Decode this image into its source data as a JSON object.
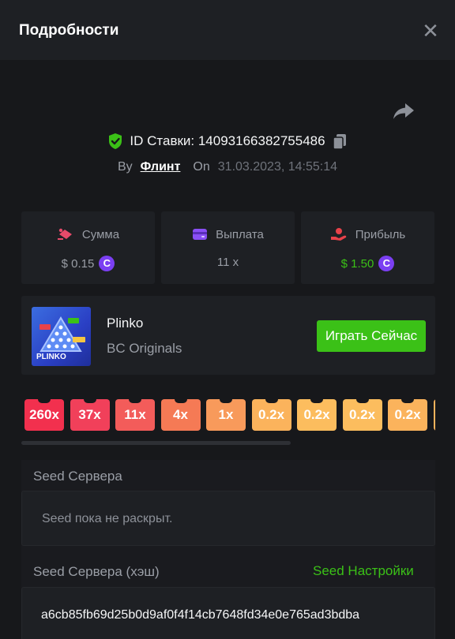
{
  "header": {
    "title": "Подробности",
    "close_icon": "close-icon"
  },
  "bet": {
    "id_label": "ID Ставки: 14093166382755486",
    "by_label": "By",
    "user": "Флинт",
    "on_label": "On",
    "date": "31.03.2023, 14:55:14"
  },
  "stats": {
    "amount": {
      "label": "Сумма",
      "value": "$ 0.15",
      "coin": "C"
    },
    "payout": {
      "label": "Выплата",
      "value": "11 x"
    },
    "profit": {
      "label": "Прибыль",
      "value": "$ 1.50",
      "coin": "C"
    }
  },
  "game": {
    "thumb_label": "PLINKO",
    "name": "Plinko",
    "provider": "BC Originals",
    "play_label": "Играть Сейчас"
  },
  "multipliers": [
    {
      "label": "260x",
      "color": "#f2304e"
    },
    {
      "label": "37x",
      "color": "#f1405a"
    },
    {
      "label": "11x",
      "color": "#f35c5a"
    },
    {
      "label": "4x",
      "color": "#f57a55"
    },
    {
      "label": "1x",
      "color": "#f89a5b"
    },
    {
      "label": "0.2x",
      "color": "#fbb35c"
    },
    {
      "label": "0.2x",
      "color": "#fcbd5e"
    },
    {
      "label": "0.2x",
      "color": "#fcbd5e"
    },
    {
      "label": "0.2x",
      "color": "#fbb35c"
    }
  ],
  "seed": {
    "server_label": "Seed Сервера",
    "server_value": "Seed пока не раскрыт.",
    "hash_label": "Seed Сервера (хэш)",
    "settings_label": "Seed Настройки",
    "hash_value": "a6cb85fb69d25b0d9af0f4f14cb7648fd34e0e765ad3bdba"
  },
  "colors": {
    "accent_green": "#3bc117",
    "coin_purple": "#7b3ff2",
    "panel_bg": "#1e2024"
  }
}
